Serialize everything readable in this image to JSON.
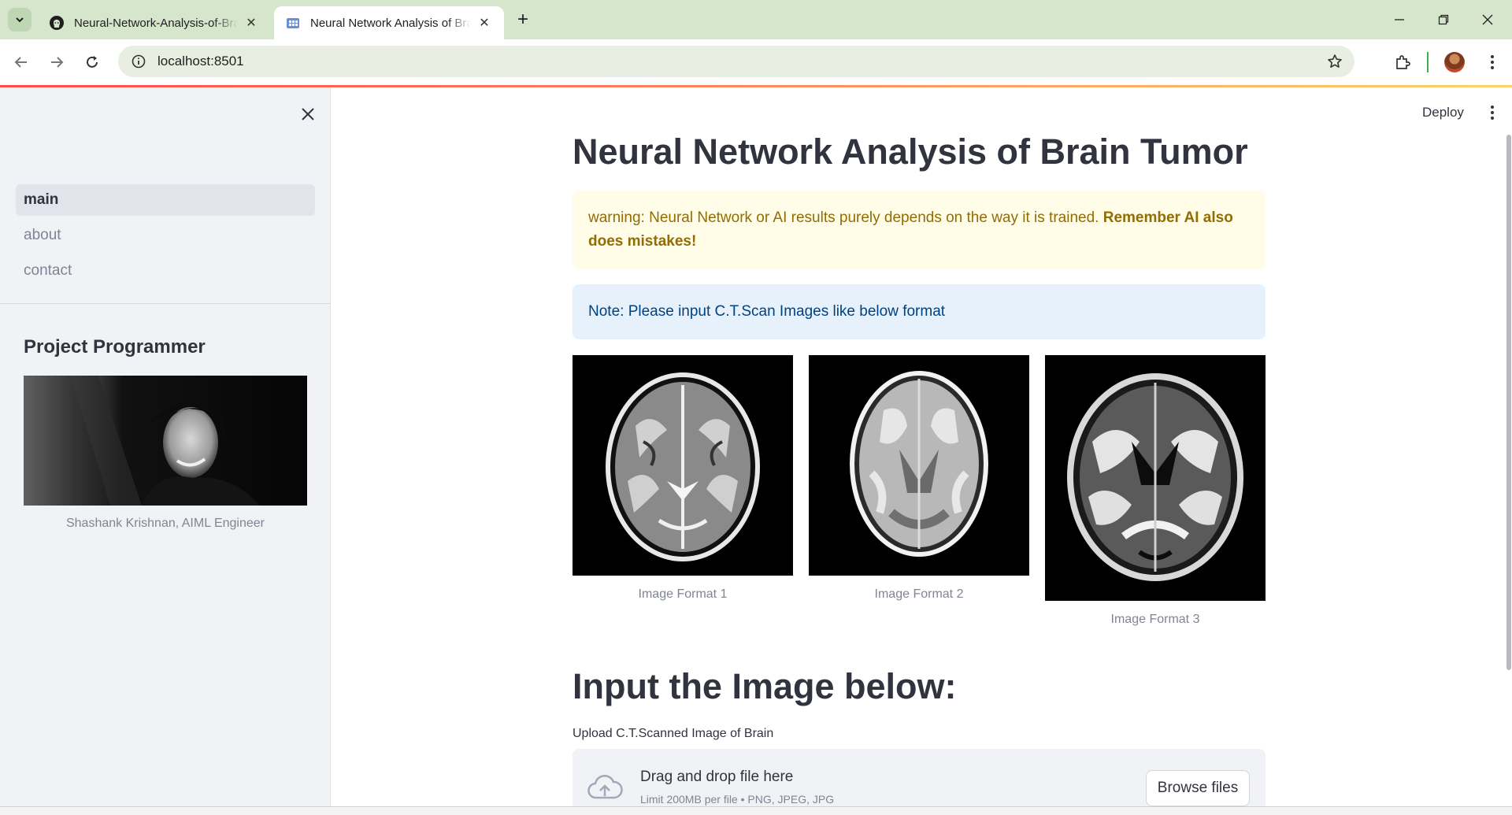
{
  "browser": {
    "tabs": [
      {
        "title": "Neural-Network-Analysis-of-Brain-Tumor",
        "icon": "github-icon",
        "active": false
      },
      {
        "title": "Neural Network Analysis of Brain Tumor",
        "icon": "streamlit-icon",
        "active": true
      }
    ],
    "url": "localhost:8501"
  },
  "sidebar": {
    "nav_items": [
      {
        "label": "main",
        "active": true
      },
      {
        "label": "about",
        "active": false
      },
      {
        "label": "contact",
        "active": false
      }
    ],
    "heading": "Project Programmer",
    "photo_caption": "Shashank Krishnan, AIML Engineer"
  },
  "header": {
    "deploy_label": "Deploy"
  },
  "main": {
    "title": "Neural Network Analysis of Brain Tumor",
    "warning_text": "warning: Neural Network or AI results purely depends on the way it is trained. ",
    "warning_bold": "Remember AI also does mistakes!",
    "info_text": "Note: Please input C.T.Scan Images like below format",
    "images": [
      {
        "caption": "Image Format 1"
      },
      {
        "caption": "Image Format 2"
      },
      {
        "caption": "Image Format 3"
      }
    ],
    "upload_heading": "Input the Image below:",
    "upload_label": "Upload C.T.Scanned Image of Brain",
    "dropzone_title": "Drag and drop file here",
    "dropzone_limit": "Limit 200MB per file • PNG, JPEG, JPG",
    "browse_label": "Browse files"
  },
  "colors": {
    "accent": "#ff4b4b",
    "sidebar_bg": "#f0f2f6",
    "warning_bg": "#fffce7",
    "warning_text": "#926c05",
    "info_bg": "#e6f1fc",
    "info_text": "#004280"
  }
}
